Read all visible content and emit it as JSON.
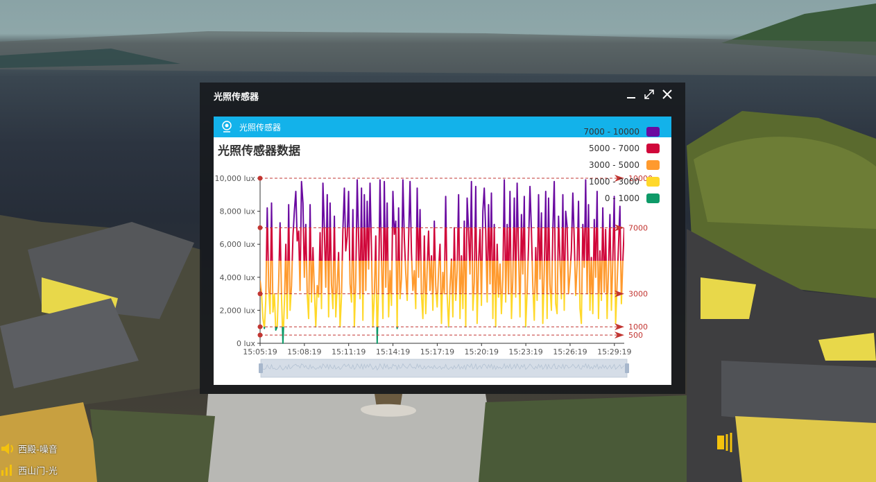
{
  "window": {
    "title": "光照传感器",
    "controls": {
      "minimize_icon": "minimize-icon",
      "maximize_icon": "maximize-icon",
      "close_icon": "close-icon"
    }
  },
  "tab": {
    "label": "光照传感器",
    "icon": "sensor-icon"
  },
  "colors": {
    "tab_bar": "#13b2ea",
    "band_7000_10000": "#6a0aa0",
    "band_5000_7000": "#d0073a",
    "band_3000_5000": "#ff9a2e",
    "band_1000_3000": "#ffd82a",
    "band_0_1000": "#0e9a68",
    "mark_line": "#c23531"
  },
  "scene_tags": [
    {
      "text": "西殿-噪音",
      "icon": "speaker-icon"
    },
    {
      "text": "西山门-光",
      "icon": "signal-icon"
    }
  ],
  "chart_data": {
    "type": "line",
    "title": "光照传感器数据",
    "y_unit": "lux",
    "ylim": [
      0,
      10000
    ],
    "y_ticks": [
      "10,000 lux",
      "8,000 lux",
      "6,000 lux",
      "4,000 lux",
      "2,000 lux",
      "0 lux"
    ],
    "x_ticks": [
      "15:05:19",
      "15:08:19",
      "15:11:19",
      "15:14:19",
      "15:17:19",
      "15:20:19",
      "15:23:19",
      "15:26:19",
      "15:29:19"
    ],
    "x_start_seconds": 54319,
    "x_end_seconds": 55799,
    "legend_position": "top-right",
    "legend": [
      {
        "label": "7000 - 10000",
        "min": 7000,
        "max": 10000
      },
      {
        "label": "5000 - 7000",
        "min": 5000,
        "max": 7000
      },
      {
        "label": "3000 - 5000",
        "min": 3000,
        "max": 5000
      },
      {
        "label": "1000 - 3000",
        "min": 1000,
        "max": 3000
      },
      {
        "label": "0 - 1000",
        "min": 0,
        "max": 1000
      }
    ],
    "mark_lines": [
      {
        "value": 10000,
        "label": "10000"
      },
      {
        "value": 7000,
        "label": "7000"
      },
      {
        "value": 3000,
        "label": "3000"
      },
      {
        "value": 1000,
        "label": "1000"
      },
      {
        "value": 500,
        "label": "500"
      }
    ],
    "data_zoom": {
      "start": 0,
      "end": 100
    },
    "values": [
      3800,
      3000,
      1500,
      900,
      2600,
      8200,
      3400,
      1800,
      8500,
      1900,
      3000,
      800,
      1000,
      3700,
      7300,
      2800,
      0,
      2400,
      6000,
      1500,
      8400,
      2000,
      3500,
      6500,
      8000,
      9200,
      6200,
      6800,
      3200,
      9800,
      8500,
      4000,
      7200,
      3000,
      1500,
      8400,
      2500,
      5800,
      3200,
      1000,
      3500,
      2800,
      6700,
      2100,
      9700,
      7000,
      3400,
      9000,
      1600,
      8500,
      3600,
      2100,
      7700,
      1600,
      3500,
      5500,
      1000,
      2900,
      6900,
      9400,
      5600,
      6500,
      9200,
      3600,
      2500,
      8100,
      1000,
      3800,
      9900,
      6300,
      2700,
      9400,
      1400,
      9000,
      3200,
      8600,
      4500,
      9700,
      5600,
      1000,
      2900,
      6500,
      0,
      3500,
      9900,
      5200,
      1500,
      9800,
      3400,
      8500,
      1600,
      4400,
      2300,
      9200,
      6600,
      7400,
      900,
      8200,
      2700,
      3900,
      9900,
      6400,
      4300,
      2600,
      6300,
      9800,
      5500,
      3200,
      4400,
      2100,
      9400,
      4000,
      8100,
      3000,
      1500,
      6500,
      1800,
      4500,
      6800,
      3200,
      5300,
      2000,
      7400,
      3500,
      2200,
      4500,
      6000,
      1200,
      4300,
      3000,
      8900,
      2900,
      1000,
      3400,
      5100,
      1600,
      7000,
      2600,
      4400,
      9000,
      1500,
      5300,
      2100,
      7400,
      1000,
      8800,
      6800,
      4200,
      9800,
      2000,
      3700,
      9500,
      1200,
      4900,
      6900,
      2300,
      8000,
      9400,
      6800,
      2500,
      8400,
      3600,
      9100,
      1500,
      7200,
      1000,
      6000,
      2800,
      4800,
      1800,
      3900,
      9900,
      2500,
      7200,
      3000,
      9200,
      1500,
      3900,
      8800,
      2800,
      9700,
      5600,
      1600,
      7800,
      4200,
      8900,
      1000,
      3100,
      6000,
      9500,
      6800,
      3500,
      1400,
      5800,
      2600,
      9000,
      3900,
      7900,
      1200,
      4300,
      9200,
      1500,
      8800,
      3600,
      2000,
      6900,
      9800,
      2400,
      1800,
      7700,
      5000,
      2700,
      9000,
      2000,
      8000,
      7100,
      3000,
      4200,
      5600,
      9100,
      6300,
      2900,
      4800,
      8600,
      2100,
      1200,
      7200,
      4600,
      9900,
      3000,
      8400,
      2000,
      5200,
      1800,
      7500,
      4000,
      9200,
      1500,
      5600,
      2600,
      8200,
      3100,
      6900,
      1500,
      4700,
      7800,
      2000,
      5000,
      8900,
      1200,
      3600,
      6000,
      8300,
      2400,
      4900,
      7000
    ]
  }
}
